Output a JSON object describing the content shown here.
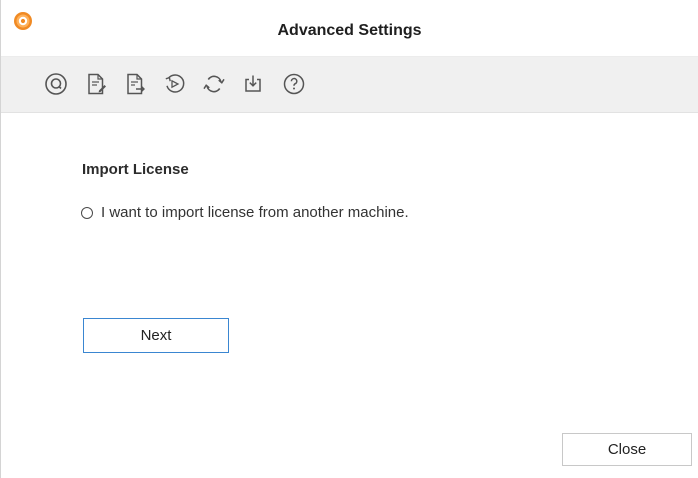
{
  "window": {
    "title": "Advanced Settings",
    "app_icon": "orange-circle-icon"
  },
  "toolbar": {
    "buttons": [
      {
        "icon": "search-icon"
      },
      {
        "icon": "document-edit-icon"
      },
      {
        "icon": "document-export-icon"
      },
      {
        "icon": "play-history-icon"
      },
      {
        "icon": "refresh-icon"
      },
      {
        "icon": "import-icon"
      },
      {
        "icon": "help-icon"
      }
    ]
  },
  "import_license": {
    "title": "Import License",
    "option_label": "I want to import license from another machine.",
    "option_selected": false,
    "next_label": "Next"
  },
  "footer": {
    "close_label": "Close"
  },
  "colors": {
    "accent": "#3a86d1",
    "toolbar_bg": "#f0f0f0",
    "icon_orange": "#f08a24"
  }
}
